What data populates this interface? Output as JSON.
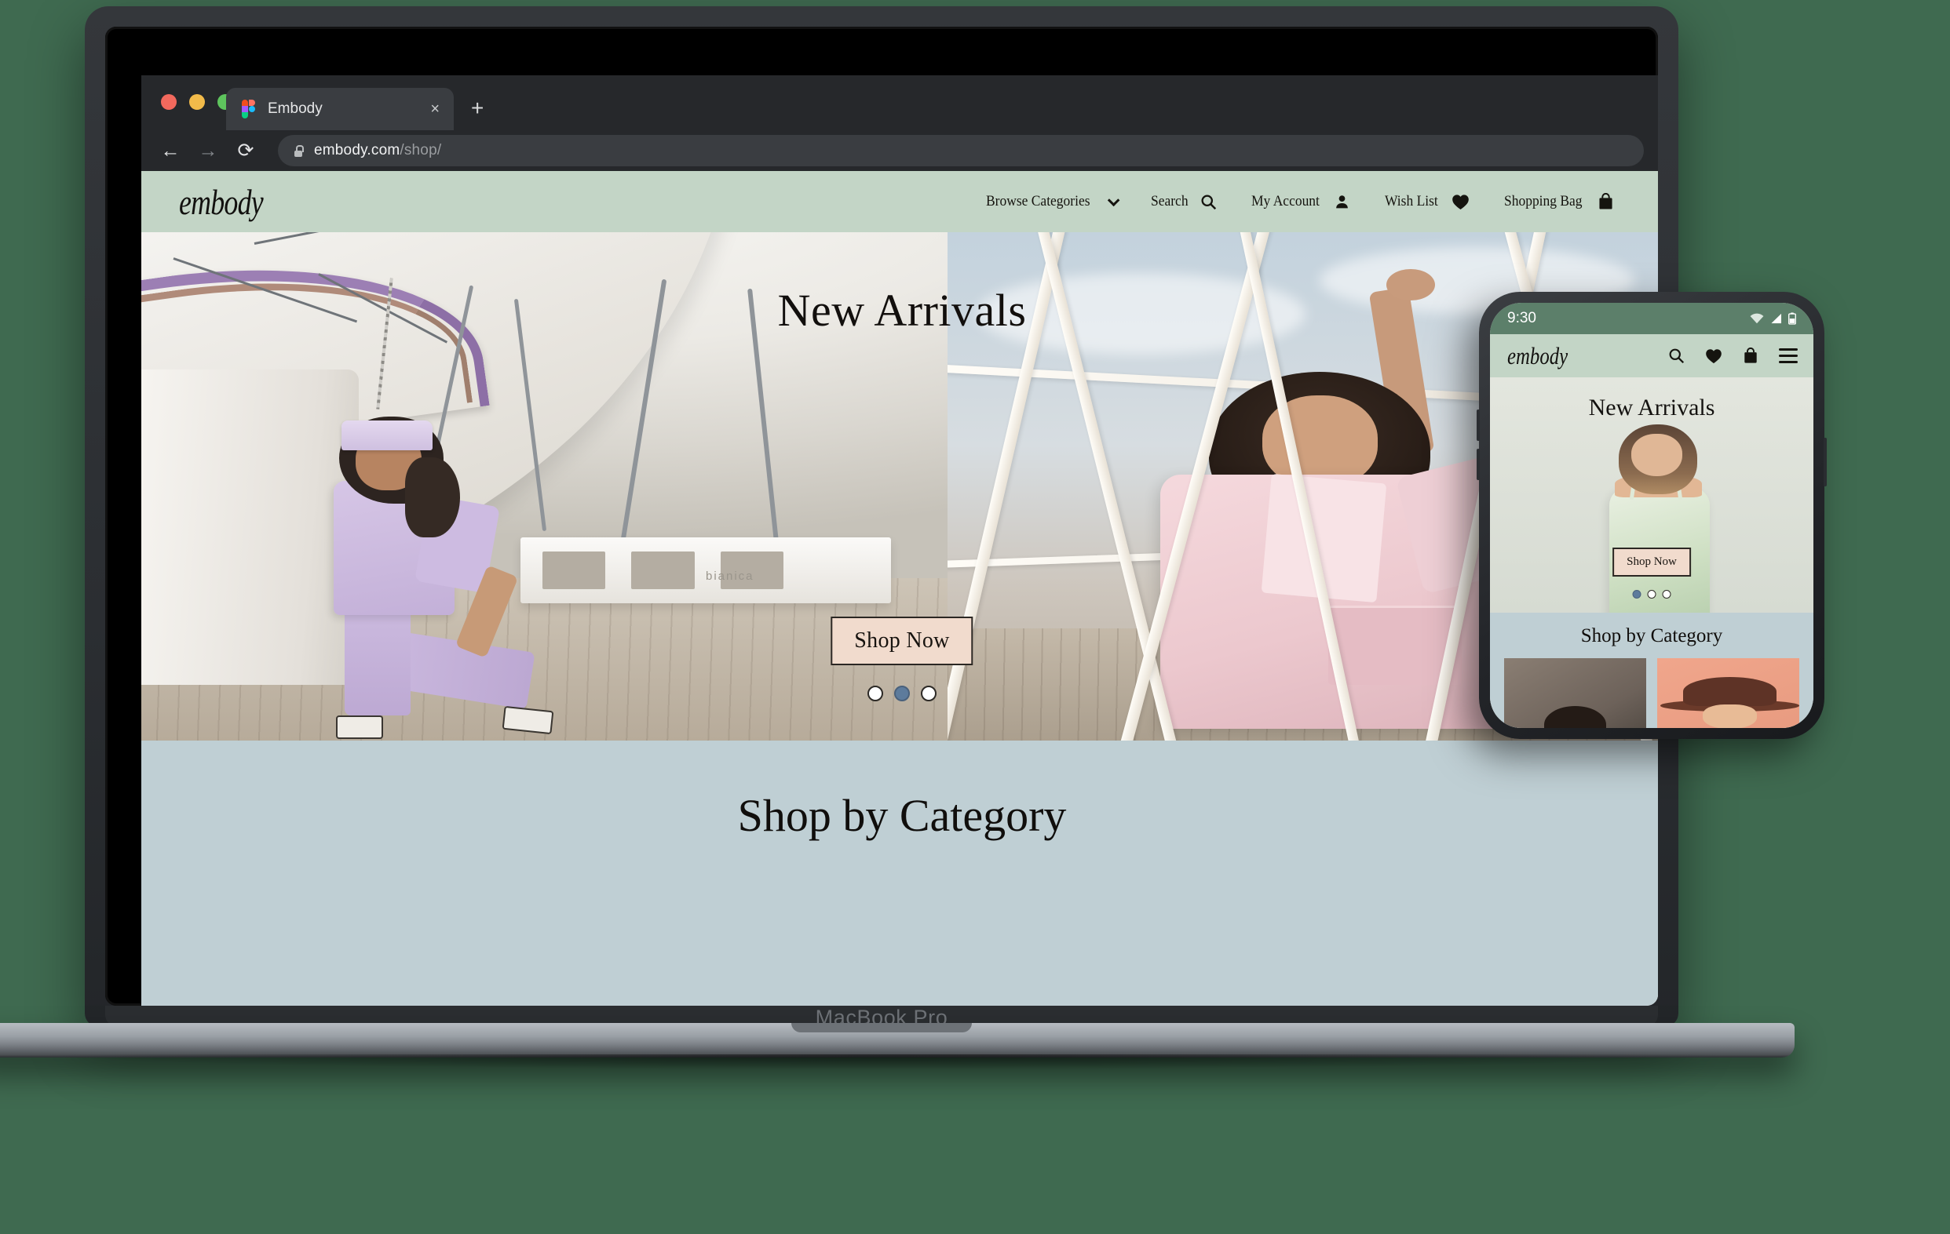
{
  "page": {
    "background_color": "#3f6a50",
    "devices": [
      "laptop",
      "phone"
    ]
  },
  "laptop": {
    "model_label": "MacBook Pro",
    "browser": {
      "traffic_lights": [
        "close-red",
        "minimize-yellow",
        "maximize-green"
      ],
      "tab": {
        "title": "Embody",
        "favicon": "figma-icon",
        "close_label": "×"
      },
      "new_tab_label": "+",
      "back_icon": "←",
      "forward_icon": "→",
      "reload_icon": "⟳",
      "lock_icon": "lock-icon",
      "url_domain": "embody.com",
      "url_path": "/shop/"
    },
    "site": {
      "brand": "embody",
      "header_bg": "#c3d5c6",
      "nav": [
        {
          "label": "Browse Categories",
          "icon": "chevron-down-icon"
        },
        {
          "label": "Search",
          "icon": "search-icon"
        },
        {
          "label": "My Account",
          "icon": "person-icon"
        },
        {
          "label": "Wish List",
          "icon": "heart-icon"
        },
        {
          "label": "Shopping Bag",
          "icon": "shopping-bag-icon"
        }
      ],
      "hero": {
        "title": "New Arrivals",
        "cta_label": "Shop Now",
        "cta_bg": "#f1dbcd",
        "sign_text": "bianica",
        "carousel": {
          "count": 3,
          "active_index": 1,
          "active_color": "#5d7b9c"
        }
      },
      "category_section": {
        "title": "Shop by Category",
        "bg": "#bfcfd4"
      }
    }
  },
  "phone": {
    "status_bar": {
      "time": "9:30",
      "bg": "#5c7f6a",
      "icons": [
        "wifi-icon",
        "cellular-signal-icon",
        "battery-icon"
      ]
    },
    "header": {
      "brand": "embody",
      "bg": "#c3d5c6",
      "icons": [
        "search-icon",
        "heart-icon",
        "shopping-bag-icon",
        "hamburger-menu-icon"
      ]
    },
    "hero": {
      "title": "New Arrivals",
      "cta_label": "Shop Now",
      "carousel": {
        "count": 3,
        "active_index": 0,
        "active_color": "#5d7b9c"
      }
    },
    "category_section": {
      "title": "Shop by Category",
      "bg": "#bfcfd4",
      "thumbnails": [
        "category-thumbnail-portrait",
        "category-thumbnail-hat"
      ]
    }
  }
}
